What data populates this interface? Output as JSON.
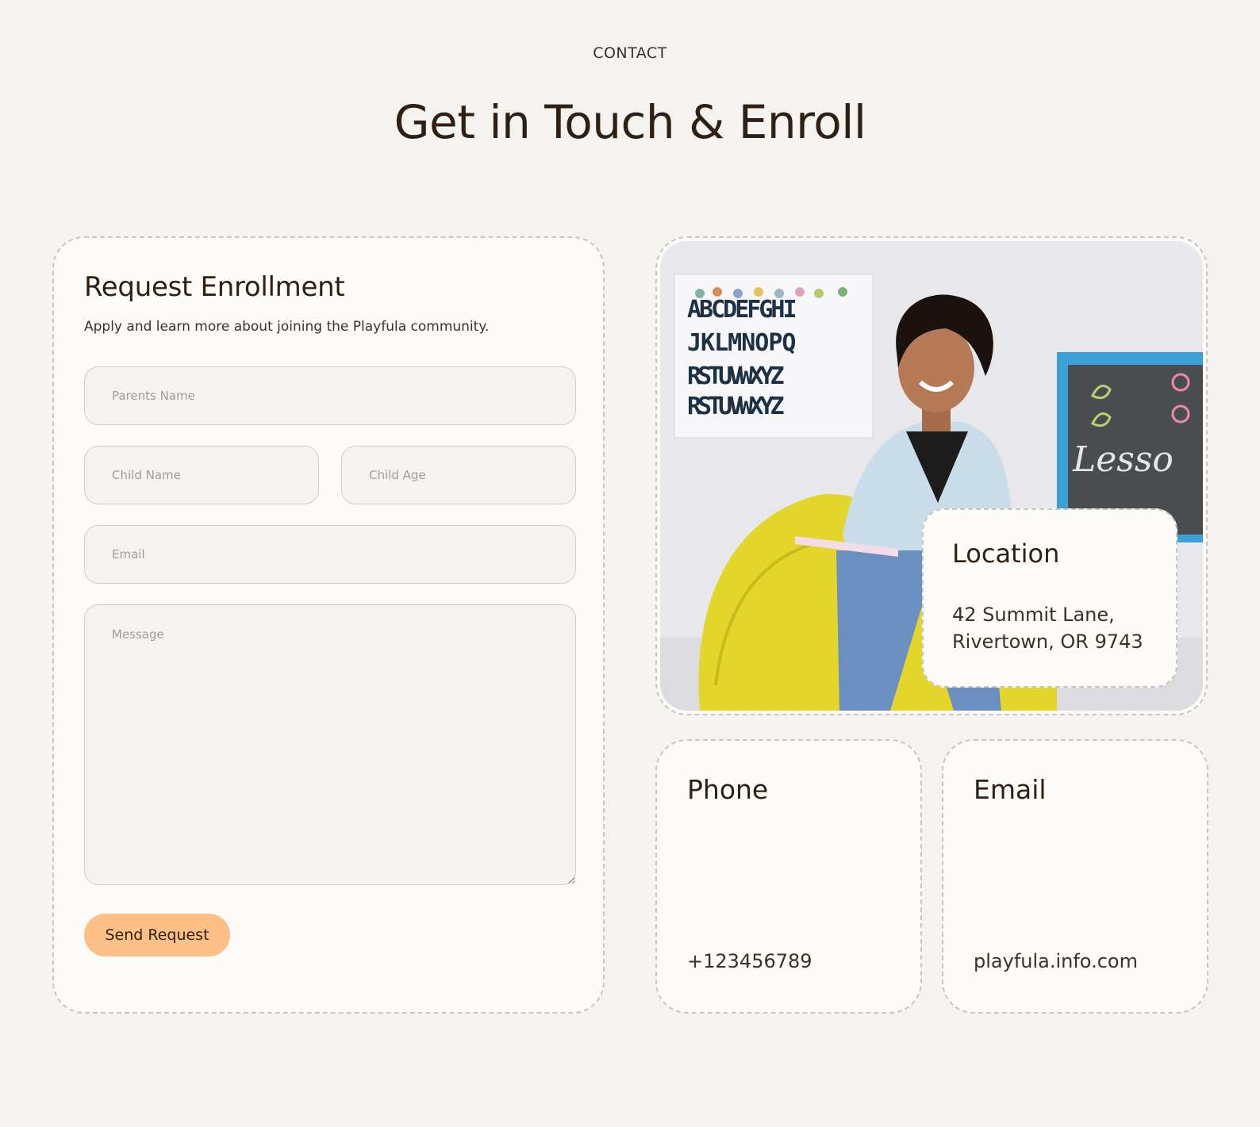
{
  "header": {
    "eyebrow": "CONTACT",
    "title": "Get in Touch & Enroll"
  },
  "form": {
    "title": "Request Enrollment",
    "subtitle": "Apply and learn more about joining the Playfula community.",
    "fields": {
      "parents_name": {
        "placeholder": "Parents Name",
        "value": ""
      },
      "child_name": {
        "placeholder": "Child Name",
        "value": ""
      },
      "child_age": {
        "placeholder": "Child Age",
        "value": ""
      },
      "email": {
        "placeholder": "Email",
        "value": ""
      },
      "message": {
        "placeholder": "Message",
        "value": ""
      }
    },
    "submit_label": "Send Request"
  },
  "photo": {
    "alphabet_rows": [
      "ABCDEFGHI",
      "JKLMNOPQ",
      "RSTUVWXYZ",
      "RSTUVWXYZ"
    ],
    "chalkboard_text": "Lesso"
  },
  "location": {
    "title": "Location",
    "line1": "42 Summit Lane,",
    "line2": "Rivertown, OR 9743"
  },
  "phone": {
    "title": "Phone",
    "value": "+123456789"
  },
  "email": {
    "title": "Email",
    "value": "playfula.info.com"
  },
  "colors": {
    "background": "#f5f3ef",
    "card": "#fcfbf8",
    "text": "#2f2013",
    "button": "#fcc086",
    "border": "#c8c6c1"
  }
}
